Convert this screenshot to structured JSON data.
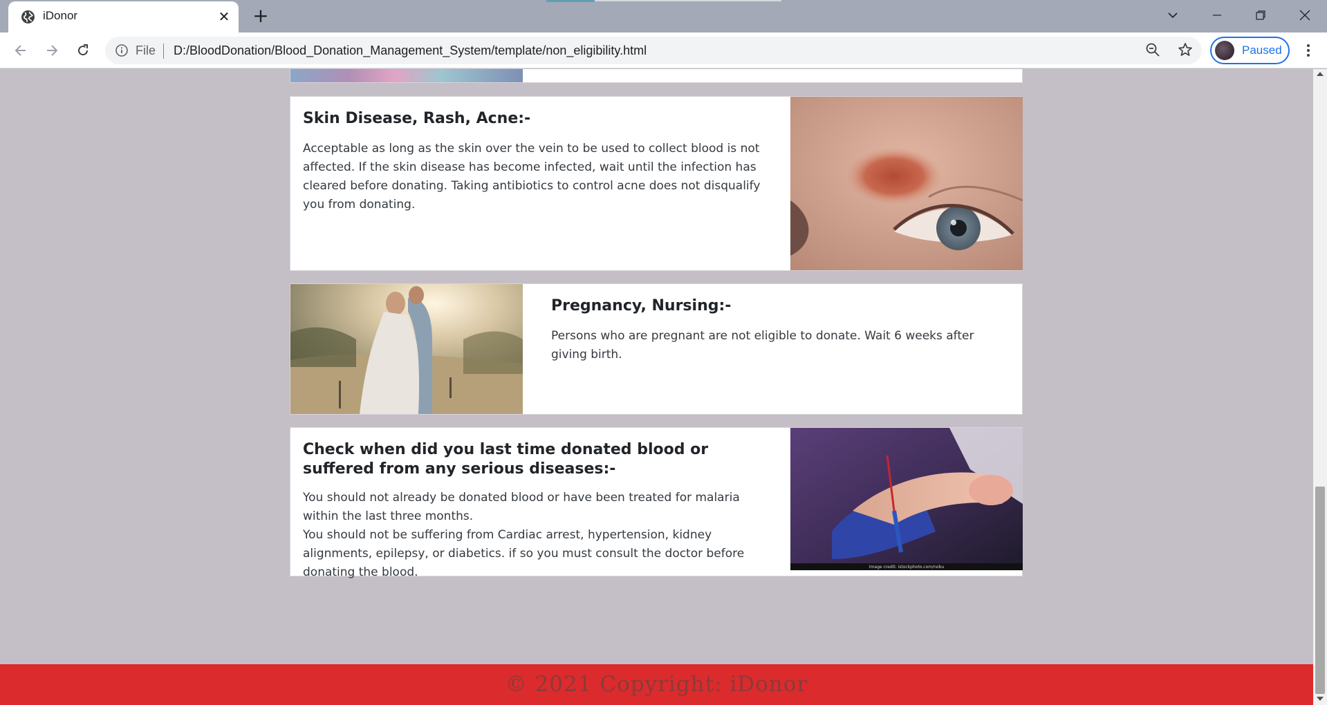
{
  "browser": {
    "tab_title": "iDonor",
    "tab_close": "✕",
    "new_tab": "+",
    "address_prefix": "File",
    "url": "D:/BloodDonation/Blood_Donation_Management_System/template/non_eligibility.html",
    "profile_label": "Paused"
  },
  "page": {
    "cards": [
      {
        "title": "Skin Disease, Rash, Acne:-",
        "text": "Acceptable as long as the skin over the vein to be used to collect blood is not affected. If the skin disease has become infected, wait until the infection has cleared before donating. Taking antibiotics to control acne does not disqualify you from donating."
      },
      {
        "title": "Pregnancy, Nursing:-",
        "text": "Persons who are pregnant are not eligible to donate. Wait 6 weeks after giving birth."
      },
      {
        "title": "Check when did you last time donated blood or suffered from any serious diseases:-",
        "text_1": "You should not already be donated blood or have been treated for malaria within the last three months.",
        "text_2": "You should not be suffering from Cardiac arrest, hypertension, kidney alignments, epilepsy, or diabetics. if so you must consult the doctor before donating the blood.",
        "image_credit": "Image credit: istockphoto.com/nobu"
      }
    ],
    "footer": "© 2021 Copyright: iDonor"
  }
}
